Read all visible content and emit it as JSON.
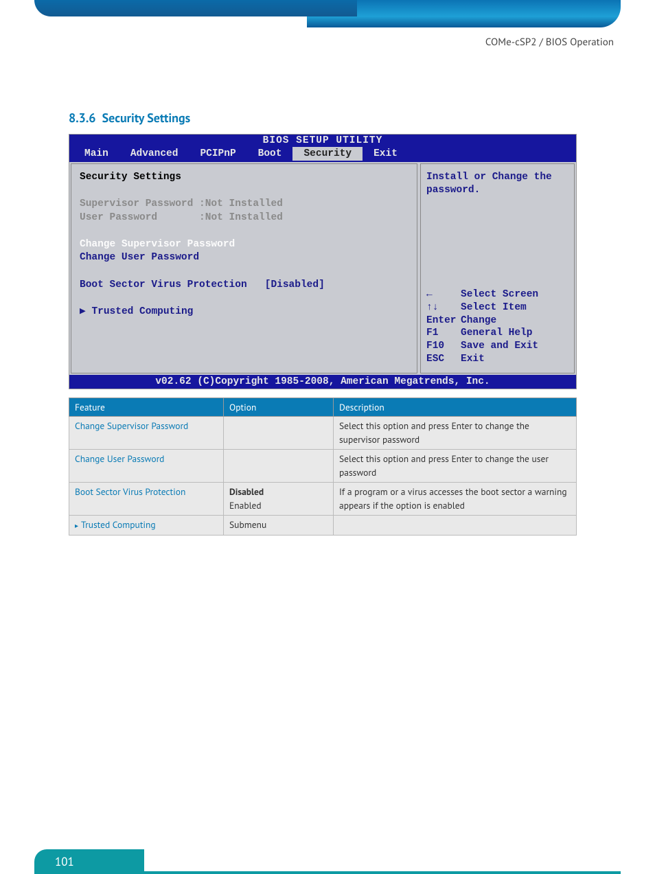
{
  "header": {
    "breadcrumb": "COMe-cSP2 / BIOS Operation"
  },
  "section": {
    "number": "8.3.6",
    "title": "Security Settings"
  },
  "bios": {
    "utility_title": "BIOS SETUP UTILITY",
    "tabs": [
      "Main",
      "Advanced",
      "PCIPnP",
      "Boot",
      "Security",
      "Exit"
    ],
    "active_tab": "Security",
    "panel_title": "Security Settings",
    "supervisor_label": "Supervisor Password",
    "supervisor_value": ":Not Installed",
    "user_label": "User Password",
    "user_value": ":Not Installed",
    "change_supervisor": "Change Supervisor Password",
    "change_user": "Change User Password",
    "boot_sector_label": "Boot Sector Virus Protection",
    "boot_sector_value": "[Disabled]",
    "trusted": "Trusted Computing",
    "help_text": "Install or Change the password.",
    "keys": {
      "left": "Select Screen",
      "updown": "Select Item",
      "enter": "Change",
      "f1": "General Help",
      "f10": "Save and Exit",
      "esc": "Exit"
    },
    "footer": "v02.62 (C)Copyright 1985-2008, American Megatrends, Inc."
  },
  "table": {
    "headers": [
      "Feature",
      "Option",
      "Description"
    ],
    "rows": [
      {
        "feature": "Change Supervisor Password",
        "option": "",
        "description": "Select this option and press Enter to change the supervisor password"
      },
      {
        "feature": "Change User Password",
        "option": "",
        "description": "Select this option and press Enter to change the user password"
      },
      {
        "feature": "Boot Sector Virus Protection",
        "option_bold": "Disabled",
        "option_plain": "Enabled",
        "description": "If a program or a virus accesses the boot sector a warning appears if the option is enabled"
      },
      {
        "feature": "Trusted Computing",
        "feature_prefix": "▸",
        "option": "Submenu",
        "description": ""
      }
    ]
  },
  "footer": {
    "page_number": "101"
  }
}
